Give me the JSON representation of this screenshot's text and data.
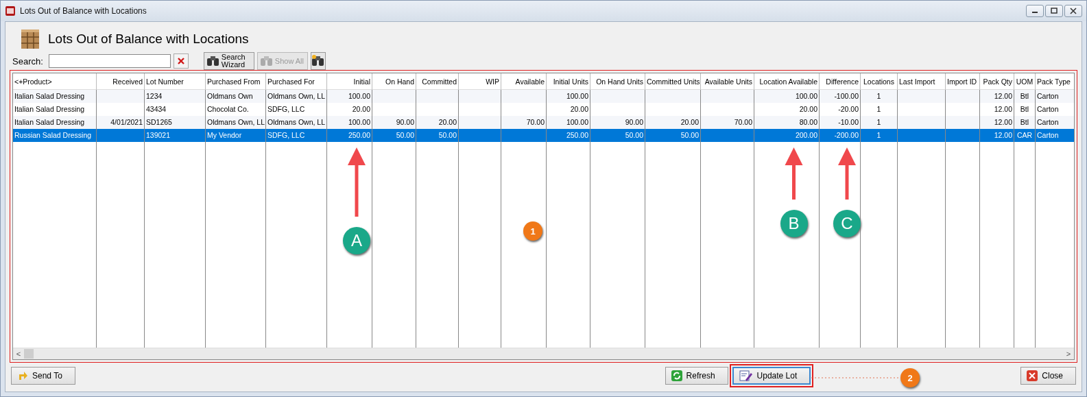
{
  "window": {
    "title": "Lots Out of Balance with Locations"
  },
  "header": {
    "title": "Lots Out of Balance with Locations"
  },
  "search": {
    "label": "Search:"
  },
  "toolbar": [
    {
      "kind": "wizard",
      "label": "Search Wizard",
      "disabled": false
    },
    {
      "kind": "showall",
      "label": "Show All",
      "disabled": true
    },
    {
      "kind": "new",
      "disabled": false
    }
  ],
  "table": {
    "columns": [
      "<+Product>",
      "Received",
      "Lot Number",
      "Purchased From",
      "Purchased For",
      "Initial",
      "On Hand",
      "Committed",
      "WIP",
      "Available",
      "Initial Units",
      "On Hand Units",
      "Committed Units",
      "Available Units",
      "Location Available",
      "Difference",
      "Locations",
      "Last Import",
      "Import ID",
      "Pack Qty",
      "UOM",
      "Pack Type"
    ],
    "rows": [
      {
        "selected": false,
        "cells": [
          "Italian Salad Dressing",
          "",
          "1234",
          "Oldmans Own",
          "Oldmans Own, LL",
          "100.00",
          "",
          "",
          "",
          "",
          "100.00",
          "",
          "",
          "",
          "100.00",
          "-100.00",
          "1",
          "",
          "",
          "12.00",
          "Btl",
          "Carton"
        ]
      },
      {
        "selected": false,
        "cells": [
          "Italian Salad Dressing",
          "",
          "43434",
          "Chocolat Co.",
          "SDFG, LLC",
          "20.00",
          "",
          "",
          "",
          "",
          "20.00",
          "",
          "",
          "",
          "20.00",
          "-20.00",
          "1",
          "",
          "",
          "12.00",
          "Btl",
          "Carton"
        ]
      },
      {
        "selected": false,
        "cells": [
          "Italian Salad Dressing",
          "4/01/2021",
          "SD1265",
          "Oldmans Own, LL",
          "Oldmans Own, LL",
          "100.00",
          "90.00",
          "20.00",
          "",
          "70.00",
          "100.00",
          "90.00",
          "20.00",
          "70.00",
          "80.00",
          "-10.00",
          "1",
          "",
          "",
          "12.00",
          "Btl",
          "Carton"
        ]
      },
      {
        "selected": true,
        "cells": [
          "Russian Salad Dressing",
          "",
          "139021",
          "My Vendor",
          "SDFG, LLC",
          "250.00",
          "50.00",
          "50.00",
          "",
          "",
          "250.00",
          "50.00",
          "50.00",
          "",
          "200.00",
          "-200.00",
          "1",
          "",
          "",
          "12.00",
          "CAR",
          "Carton"
        ]
      }
    ]
  },
  "scroll_arrows": {
    "left": "<",
    "right": ">"
  },
  "buttons": [
    {
      "kind": "sendto",
      "label": "Send To",
      "highlighted": false
    },
    {
      "kind": "refresh",
      "label": "Refresh",
      "highlighted": false
    },
    {
      "kind": "update",
      "label": "Update Lot",
      "highlighted": true
    },
    {
      "kind": "close",
      "label": "Close",
      "highlighted": false
    }
  ],
  "annotations": [
    {
      "kind": "letter",
      "label": "A"
    },
    {
      "kind": "letter",
      "label": "B"
    },
    {
      "kind": "letter",
      "label": "C"
    },
    {
      "kind": "badge",
      "label": "1"
    },
    {
      "kind": "badge",
      "label": "2"
    }
  ]
}
